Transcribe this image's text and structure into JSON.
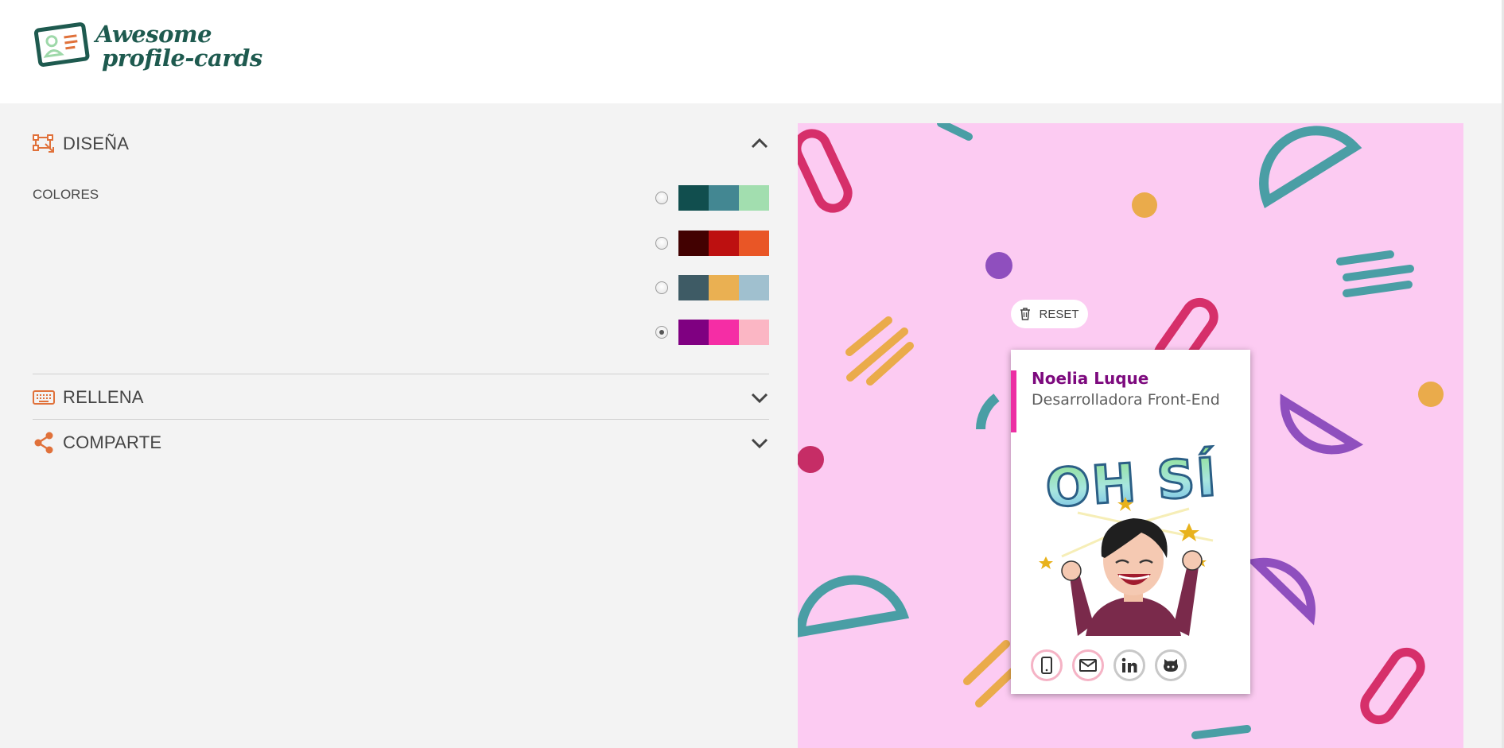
{
  "header": {
    "logo_line1": "Awesome",
    "logo_line2": "profile-cards",
    "logo_icon": "profile-card-icon"
  },
  "sections": {
    "design": {
      "title": "DISEÑA",
      "icon": "design-icon",
      "expanded": true
    },
    "fill": {
      "title": "RELLENA",
      "icon": "keyboard-icon",
      "expanded": false
    },
    "share": {
      "title": "COMPARTE",
      "icon": "share-icon",
      "expanded": false
    }
  },
  "colors": {
    "label": "COLORES",
    "palettes": [
      {
        "swatches": [
          "#114e4e",
          "#438792",
          "#a2deaf"
        ],
        "selected": false
      },
      {
        "swatches": [
          "#420101",
          "#bd1010",
          "#e95626"
        ],
        "selected": false
      },
      {
        "swatches": [
          "#3e5b65",
          "#eab052",
          "#a0c0cf"
        ],
        "selected": false
      },
      {
        "swatches": [
          "#7f0081",
          "#f52da5",
          "#fbb6c4"
        ],
        "selected": true
      }
    ]
  },
  "preview": {
    "reset_label": "RESET",
    "background": "#fccbf2",
    "card": {
      "name": "Noelia Luque",
      "job": "Desarrolladora Front-End",
      "image_caption": "OH SÍ",
      "socials": [
        "phone-icon",
        "mail-icon",
        "linkedin-icon",
        "github-icon"
      ]
    }
  },
  "theme": {
    "accent_orange": "#e0713a",
    "primary_dark": "#7f0081",
    "primary_medium": "#f52da5",
    "primary_light": "#fbb6c4"
  }
}
